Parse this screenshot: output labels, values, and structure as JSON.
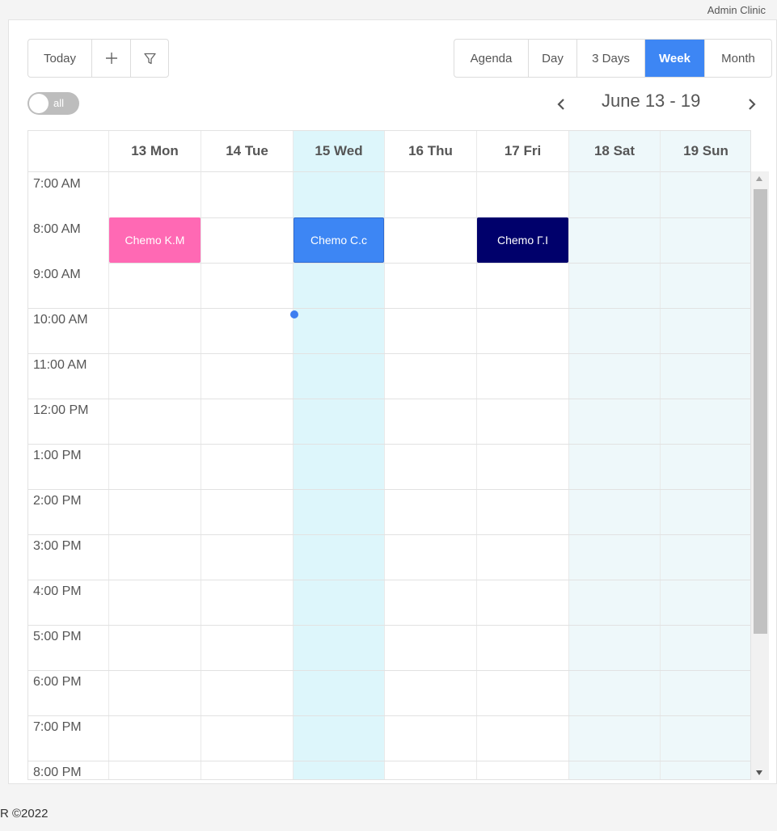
{
  "header": {
    "user_label": "Admin Clinic"
  },
  "toolbar": {
    "today_label": "Today",
    "add_icon": "plus-icon",
    "filter_icon": "filter-icon",
    "views": [
      "Agenda",
      "Day",
      "3 Days",
      "Week",
      "Month"
    ],
    "active_view": "Week",
    "toggle_label": "all",
    "toggle_state": "off",
    "range_label": "June 13 - 19"
  },
  "calendar": {
    "days": [
      "13 Mon",
      "14 Tue",
      "15 Wed",
      "16 Thu",
      "17 Fri",
      "18 Sat",
      "19 Sun"
    ],
    "highlighted_days": [
      "15 Wed",
      "18 Sat",
      "19 Sun"
    ],
    "times": [
      "7:00 AM",
      "8:00 AM",
      "9:00 AM",
      "10:00 AM",
      "11:00 AM",
      "12:00 PM",
      "1:00 PM",
      "2:00 PM",
      "3:00 PM",
      "4:00 PM",
      "5:00 PM",
      "6:00 PM",
      "7:00 PM",
      "8:00 PM"
    ],
    "events": [
      {
        "day": "13 Mon",
        "time": "8:00 AM",
        "label": "Chemo K.M",
        "color": "#ff69b4"
      },
      {
        "day": "15 Wed",
        "time": "8:00 AM",
        "label": "Chemo C.c",
        "color": "#3d86f4"
      },
      {
        "day": "17 Fri",
        "time": "8:00 AM",
        "label": "Chemo Γ.Ι",
        "color": "#00006b"
      }
    ]
  },
  "colors": {
    "accent": "#3d86f4",
    "today_bg": "#ddf6fb",
    "weekend_bg": "#eef8fa"
  },
  "footer": {
    "copyright": "R ©2022"
  }
}
